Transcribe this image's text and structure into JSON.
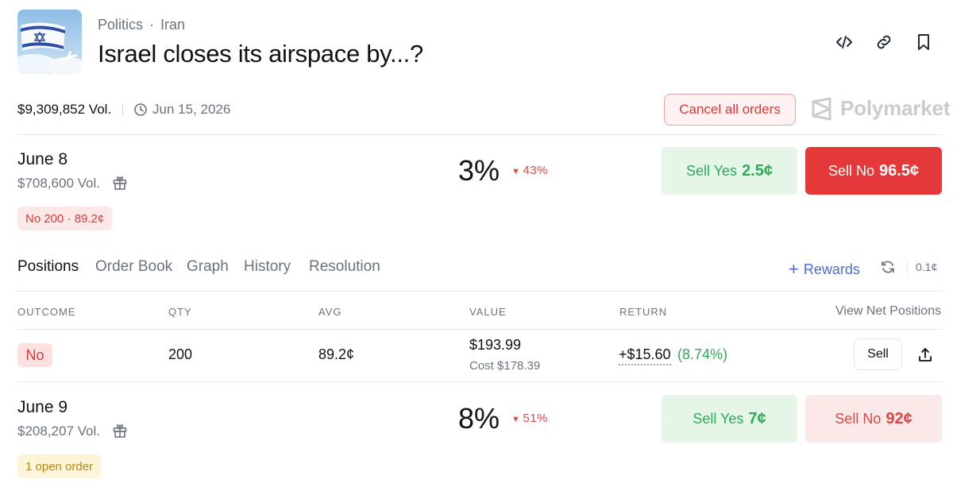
{
  "header": {
    "category": "Politics",
    "subcategory": "Iran",
    "title": "Israel closes its airspace by...?"
  },
  "summary": {
    "volume": "$9,309,852 Vol.",
    "end_date": "Jun 15, 2026",
    "cancel_label": "Cancel all orders",
    "brand": "Polymarket"
  },
  "markets": [
    {
      "name": "June 8",
      "volume": "$708,600 Vol.",
      "probability": "3%",
      "change": "43%",
      "sell_yes_label": "Sell Yes",
      "sell_yes_price": "2.5¢",
      "sell_no_label": "Sell No",
      "sell_no_price": "96.5¢",
      "badge": "No 200 · 89.2¢"
    },
    {
      "name": "June 9",
      "volume": "$208,207 Vol.",
      "probability": "8%",
      "change": "51%",
      "sell_yes_label": "Sell Yes",
      "sell_yes_price": "7¢",
      "sell_no_label": "Sell No",
      "sell_no_price": "92¢",
      "badge": "1 open order"
    }
  ],
  "tabs": {
    "items": [
      "Positions",
      "Order Book",
      "Graph",
      "History",
      "Resolution"
    ],
    "rewards_label": "Rewards",
    "tick_size": "0.1¢"
  },
  "positions": {
    "columns": [
      "OUTCOME",
      "QTY",
      "AVG",
      "VALUE",
      "RETURN"
    ],
    "view_net_label": "View Net Positions",
    "rows": [
      {
        "outcome": "No",
        "qty": "200",
        "avg": "89.2¢",
        "value": "$193.99",
        "cost": "Cost $178.39",
        "return_value": "+$15.60",
        "return_pct": "(8.74%)",
        "sell_label": "Sell"
      }
    ]
  },
  "colors": {
    "yes_green": "#2faa57",
    "no_red": "#e5383b",
    "rewards_blue": "#4f6bd8",
    "open_order_gold": "#b88a07"
  }
}
